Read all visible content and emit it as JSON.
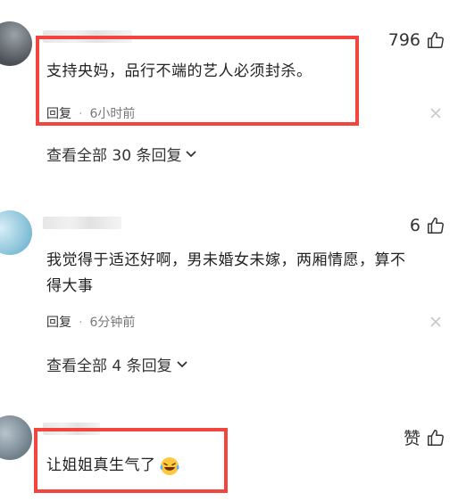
{
  "comments": [
    {
      "likes": "796",
      "text": "支持央妈，品行不端的艺人必须封杀。",
      "reply_label": "回复",
      "time": "6小时前",
      "expand_label": "查看全部 30 条回复"
    },
    {
      "likes": "6",
      "text_line1": "我觉得于适还好啊，男未婚女未嫁，两厢情愿，算不",
      "text_line2": "得大事",
      "reply_label": "回复",
      "time": "6分钟前",
      "expand_label": "查看全部 4 条回复"
    },
    {
      "likes": "赞",
      "text": "让姐姐真生气了"
    }
  ],
  "icons": {
    "like": "thumbs-up-icon",
    "close": "close-icon",
    "expand": "chevron-down-icon",
    "emoji": "laughing-crying-emoji-icon"
  },
  "colors": {
    "highlight": "#f2453d",
    "meta_text": "#777777"
  }
}
